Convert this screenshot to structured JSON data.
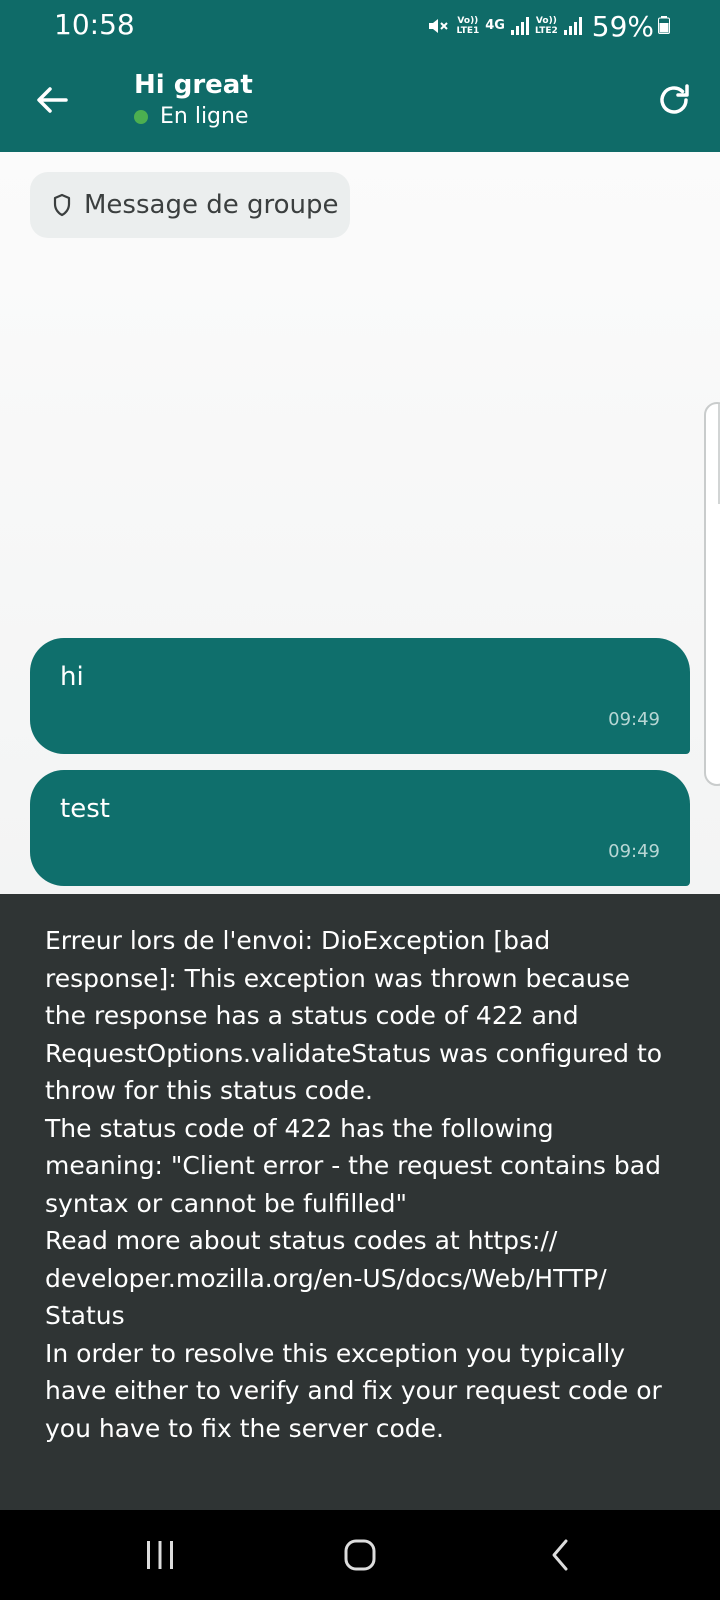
{
  "status_bar": {
    "time": "10:58",
    "sim1_label": "Vo))",
    "sim1_sub": "LTE1",
    "network": "4G",
    "sim2_label": "Vo))",
    "sim2_sub": "LTE2",
    "battery": "59%",
    "icons": [
      "mute-icon",
      "signal-icon",
      "battery-icon"
    ]
  },
  "header": {
    "title": "Hi great",
    "presence": "En ligne",
    "presence_color": "#4caf50",
    "accent": "#0f6b68"
  },
  "chat": {
    "group_chip": "Message de groupe",
    "messages": [
      {
        "text": "hi",
        "time": "09:49"
      },
      {
        "text": "test",
        "time": "09:49"
      }
    ]
  },
  "snackbar": {
    "message": "Erreur lors de l'envoi: DioException [bad\nresponse]: This exception was thrown because\nthe response has a status code of 422 and\nRequestOptions.validateStatus was configured to\nthrow for this status code.\nThe status code of 422 has the following\nmeaning: \"Client error - the request contains bad\nsyntax or cannot be fulfilled\"\nRead more about status codes at https://\ndeveloper.mozilla.org/en-US/docs/Web/HTTP/\nStatus\nIn order to resolve this exception you typically\nhave either to verify and fix your request code or\nyou have to fix the server code."
  },
  "nav": {
    "icons": [
      "recents-icon",
      "home-icon",
      "back-nav-icon"
    ]
  }
}
